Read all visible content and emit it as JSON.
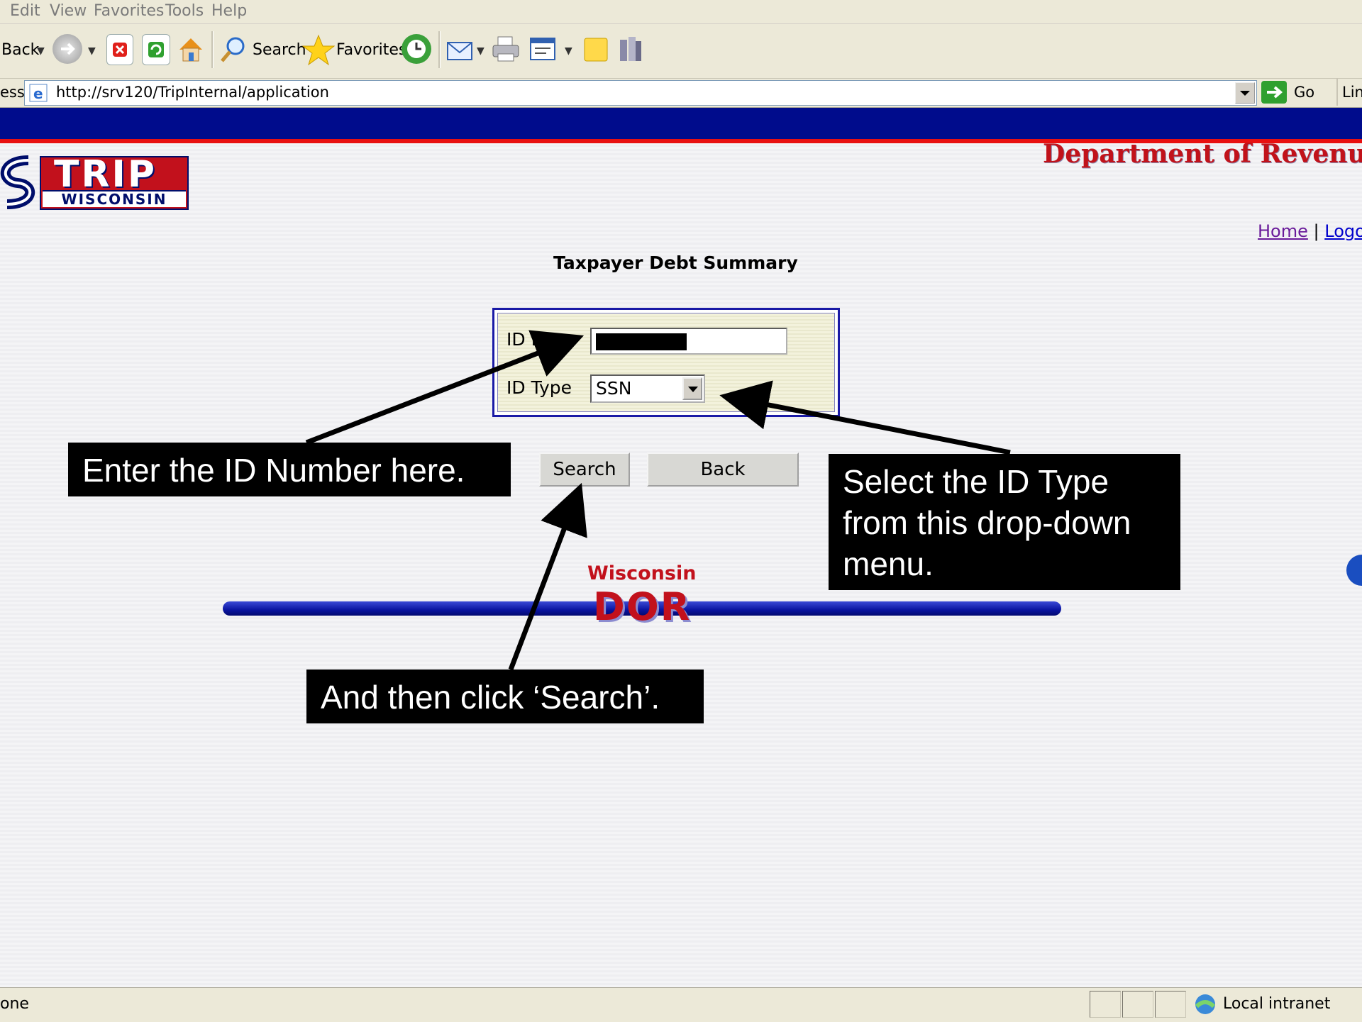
{
  "menubar": {
    "items": [
      "Edit",
      "View",
      "Favorites",
      "Tools",
      "Help"
    ]
  },
  "toolbar": {
    "back_label": "Back",
    "search_label": "Search",
    "favorites_label": "Favorites"
  },
  "addressbar": {
    "label": "ess",
    "url": "http://srv120/TripInternal/application",
    "go_label": "Go",
    "links_label": "Lin"
  },
  "header": {
    "logo_top": "TRIP",
    "logo_bottom": "WISCONSIN",
    "department": "Department of Revenu",
    "home_link": "Home",
    "separator": "|",
    "logout_link": "Logo"
  },
  "main": {
    "title": "Taxpayer Debt Summary",
    "id_no_label": "ID No",
    "id_type_label": "ID Type",
    "id_type_value": "SSN",
    "search_button": "Search",
    "back_button": "Back"
  },
  "footer_logo": {
    "top": "Wisconsin",
    "bottom": "DOR"
  },
  "callouts": {
    "id_number": "Enter the ID Number here.",
    "id_type": "Select the ID Type from this drop-down menu.",
    "search": "And then click ‘Search’."
  },
  "statusbar": {
    "text": "one",
    "zone": "Local intranet"
  },
  "colors": {
    "header_band": "#000c8c",
    "header_stripe": "#e81010",
    "brand_red": "#c2111c",
    "link": "#0000cc"
  }
}
